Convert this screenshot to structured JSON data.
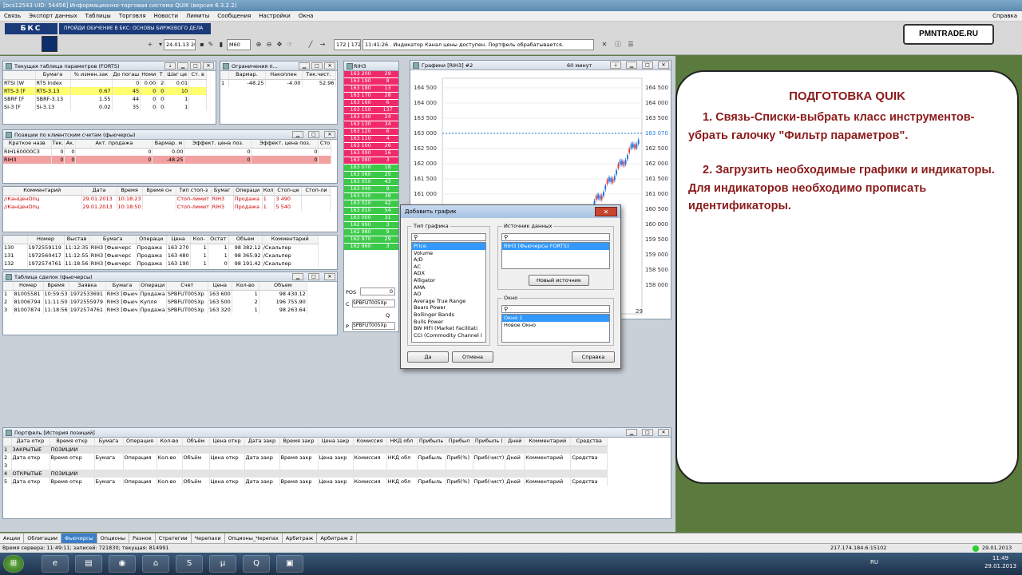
{
  "window_title": "[bcs12543  UID: 54456] Информационно-торговая система QUIK (версия 6.3.2.2)",
  "menu": [
    "Связь",
    "Экспорт данных",
    "Таблицы",
    "Торговля",
    "Новости",
    "Лимиты",
    "Сообщения",
    "Настройки",
    "Окна"
  ],
  "menu_help": "Справка",
  "toolbar": {
    "logo": "БКС",
    "banner": "ПРОЙДИ ОБУЧЕНИЕ В БКС: ОСНОВЫ БИРЖЕВОГО ДЕЛА",
    "date_field": "24.01.13 20",
    "interval_field": "M60",
    "msg_counter": "172 | 172",
    "msg_text": "11:41:26 . Индикатор Канал цены доступен. Портфель обрабатывается.",
    "watermark": "PMNTRADE.RU"
  },
  "params_table": {
    "title": "Текущая таблица параметров (FORTS)",
    "headers": [
      "",
      "Бумага",
      "% измен.",
      "Цена послед.",
      "Лот",
      "Шаг цены"
    ],
    "rows": [
      [
        "RTSI [W",
        "RTS Index",
        "",
        "0",
        "0.00",
        "2",
        "0.01"
      ],
      [
        "RTS-3 [F",
        "RTS-3.13",
        "0.67",
        "45",
        "0",
        "0",
        "10"
      ],
      [
        "SBRF [F",
        "SBRF-3.13",
        "1.55",
        "44",
        "0",
        "0",
        "1"
      ],
      [
        "SI-3 [F",
        "Si-3.13",
        "0.02",
        "35",
        "0",
        "0",
        "1"
      ]
    ],
    "header_labels": [
      "Бумага",
      "% измен.зак",
      "До погаш",
      "Номи",
      "Т",
      "Шаг це",
      "Ст. в"
    ]
  },
  "limits_table": {
    "title": "Ограничения п...",
    "headers": [
      "",
      "Вармар.",
      "Накоплен",
      "Тек.чист."
    ],
    "row": [
      "1",
      "-48.25",
      "-4.00",
      "52.96"
    ]
  },
  "positions_table": {
    "title": "Позиции по клиентским счетам (фьючерсы)",
    "headers": [
      "Краткое назв",
      "Тек.",
      "Ак.",
      "Акт. продажа",
      "Вармар. м",
      "Эффект. цена поз.",
      "Эффект. цена поз.",
      "Сто"
    ],
    "rows": [
      [
        "RIH160000СЗ",
        "0",
        "0",
        "0",
        "0.00",
        "0",
        "0"
      ],
      [
        "RIH3",
        "0",
        "0",
        "0",
        "-48.25",
        "0",
        "0"
      ]
    ]
  },
  "stops_table": {
    "headers": [
      "Комментарий",
      "Дата",
      "Время",
      "Время сн",
      "Тип стоп-з",
      "Бумаг",
      "Операци",
      "Кол",
      "Стоп-це",
      "Стоп-ли"
    ],
    "rows": [
      [
        "//КанЦенОпц",
        "29.01.2013",
        "10:18:23",
        "",
        "Стоп-лимит",
        "RIH3",
        "Продажа",
        "1",
        "3 490",
        ""
      ],
      [
        "//КанЦенОпц",
        "29.01.2013",
        "10:18:50",
        "",
        "Стоп-лимит",
        "RIH3",
        "Продажа",
        "1",
        "5 540",
        ""
      ]
    ]
  },
  "orders_table": {
    "headers": [
      "",
      "Номер",
      "Выстав",
      "Бумага",
      "Операци",
      "Цена",
      "Кол-",
      "Остат",
      "Объем",
      "Комментарий"
    ],
    "rows": [
      [
        "130",
        "1972559119",
        "11:12:35",
        "RIH3 [Фьючерс",
        "Продажа",
        "163 270",
        "1",
        "1",
        "98 382.12",
        "/Скальпер"
      ],
      [
        "131",
        "1972560417",
        "11:12:55",
        "RIH3 [Фьючерс",
        "Продажа",
        "163 480",
        "1",
        "1",
        "98 365.92",
        "/Скальпер"
      ],
      [
        "132",
        "1972574761",
        "11:18:56",
        "RIH3 [Фьючерс",
        "Продажа",
        "163 190",
        "1",
        "0",
        "98 191.42",
        "/Скальпер"
      ]
    ]
  },
  "trades_table": {
    "title": "Таблица сделок (фьючерсы)",
    "headers": [
      "",
      "Номер",
      "Время",
      "Заявка",
      "Бумага",
      "Операци",
      "Счет",
      "Цена",
      "Кол-во",
      "Объем"
    ],
    "rows": [
      [
        "1",
        "81005581",
        "10:59:53",
        "1972533691",
        "RIH3 [Фьюч",
        "Продажа",
        "SPBFUT005Xp",
        "163 600",
        "1",
        "98 430.12"
      ],
      [
        "2",
        "81006794",
        "11:11:50",
        "1972555979",
        "RIH3 [Фьюч",
        "Купля",
        "SPBFUT005Xp",
        "163 500",
        "2",
        "196 755.90"
      ],
      [
        "3",
        "81007874",
        "11:18:56",
        "1972574761",
        "RIH3 [Фьюч",
        "Продажа",
        "SPBFUT005Xp",
        "163 320",
        "1",
        "98 263.64"
      ]
    ]
  },
  "orderbook": {
    "title": "RIH3",
    "sell": [
      [
        "163 200",
        "29"
      ],
      [
        "163 190",
        "8"
      ],
      [
        "163 180",
        "13"
      ],
      [
        "163 170",
        "28"
      ],
      [
        "163 160",
        "6"
      ],
      [
        "163 150",
        "137"
      ],
      [
        "163 140",
        "24"
      ],
      [
        "163 130",
        "34"
      ],
      [
        "163 120",
        "6"
      ],
      [
        "163 110",
        "4"
      ],
      [
        "163 100",
        "26"
      ],
      [
        "163 090",
        "16"
      ],
      [
        "163 080",
        "3"
      ]
    ],
    "buy": [
      [
        "163 070",
        "18"
      ],
      [
        "163 060",
        "25"
      ],
      [
        "163 050",
        "43"
      ],
      [
        "163 040",
        "9"
      ],
      [
        "163 030",
        "38"
      ],
      [
        "163 020",
        "42"
      ],
      [
        "163 010",
        "54"
      ],
      [
        "163 000",
        "31"
      ],
      [
        "162 990",
        "3"
      ],
      [
        "162 980",
        "9"
      ],
      [
        "162 970",
        "29"
      ],
      [
        "162 960",
        "3"
      ]
    ],
    "pos_label": "POS",
    "pos_value": "0",
    "account_c": "SPBFUT005Xp",
    "account_p": "SPBFUT005Xp",
    "row_labels": [
      "C",
      "Q",
      "P"
    ]
  },
  "chart": {
    "title": "Графики [RIH3] #2",
    "interval": "60 минут",
    "left_ticks": [
      "164 500",
      "164 000",
      "163 500",
      "163 000",
      "162 500",
      "162 000",
      "161 500",
      "161 000"
    ],
    "right_ticks": [
      "164 500",
      "164 000",
      "163 500",
      "163 070",
      "162 500",
      "162 000",
      "161 500",
      "161 000",
      "160 500",
      "160 000",
      "159 500",
      "159 000",
      "158 500",
      "158 000"
    ],
    "last_price": "163 070",
    "date_tick": "29"
  },
  "dialog": {
    "title": "Добавить график",
    "type_label": "Тип графика",
    "types": [
      "Price",
      "Volume",
      "A/D",
      "AC",
      "ADX",
      "Alligator",
      "AMA",
      "AO",
      "Average True Range",
      "Bears Power",
      "Bollinger Bands",
      "Bulls Power",
      "BW MFI (Market Facilitati",
      "CCI (Commodity Channel I"
    ],
    "selected_type": "Price",
    "source_label": "Источник данных",
    "sources": [
      "RIH3 [Фьючерсы FORTS]"
    ],
    "new_source_btn": "Новый источник",
    "window_label": "Окно",
    "windows": [
      "Окно 1",
      "Новое Окно"
    ],
    "ok_btn": "Да",
    "cancel_btn": "Отмена",
    "help_btn": "Справка"
  },
  "portfolio": {
    "title": "Портфель [История позиций]",
    "headers": [
      "",
      "Дата откр",
      "Время откр",
      "Бумага",
      "Операция",
      "Кол-во",
      "Объём",
      "Цена откр",
      "Дата закр",
      "Время закр",
      "Цена закр",
      "Комиссия",
      "НКД обл",
      "Прибыль",
      "Прибыл",
      "Прибыль (",
      "Дней",
      "Комментарий",
      "Средства"
    ],
    "rows": [
      [
        "1",
        "ЗАКРЫТЫЕ",
        "ПОЗИЦИИ",
        "",
        "",
        "",
        "",
        "",
        "",
        "",
        "",
        "",
        "",
        "",
        "",
        "",
        "",
        "",
        ""
      ],
      [
        "2",
        "Дата откр",
        "Время откр",
        "Бумага",
        "Операция",
        "Кол-во",
        "Объём",
        "Цена откр",
        "Дата закр",
        "Время закр",
        "Цена закр",
        "Комиссия",
        "НКД обл",
        "Прибыль",
        "Приб(%)",
        "Приб(чист)",
        "Дней",
        "Комментарий",
        "Средства"
      ],
      [
        "3",
        "",
        "",
        "",
        "",
        "",
        "",
        "",
        "",
        "",
        "",
        "",
        "",
        "",
        "",
        "",
        "",
        "",
        ""
      ],
      [
        "4",
        "ОТКРЫТЫЕ",
        "ПОЗИЦИИ",
        "",
        "",
        "",
        "",
        "",
        "",
        "",
        "",
        "",
        "",
        "",
        "",
        "",
        "",
        "",
        ""
      ],
      [
        "5",
        "Дата откр",
        "Время откр",
        "Бумага",
        "Операция",
        "Кол-во",
        "Объём",
        "Цена откр",
        "Дата закр",
        "Время закр",
        "Цена закр",
        "Комиссия",
        "НКД обл",
        "Прибыль",
        "Приб(%)",
        "Приб(чист)",
        "Дней",
        "Комментарий",
        "Средства"
      ]
    ]
  },
  "tabs": [
    "Акции",
    "Облигации",
    "Фьючерсы",
    "Опционы",
    "Разное",
    "Стратегии",
    "Черепахи",
    "Опционы_Черепах",
    "Арбитраж",
    "Арбитраж 2"
  ],
  "active_tab": "Фьючерсы",
  "status": {
    "server_time": "Время сервера: 11:49:11; записей: 721830; текущая: 814991",
    "connection": "217.174.184.6:15102",
    "date": "29.01.2013"
  },
  "taskbar": {
    "lang": "RU",
    "time": "11:49",
    "date": "29.01.2013"
  },
  "note": {
    "heading": "ПОДГОТОВКА QUIK",
    "p1": "1. Связь-Списки-выбрать класс инструментов-убрать галочку \"Фильтр параметров\".",
    "p2": "2. Загрузить необходимые графики и индикаторы. Для индикаторов необходимо прописать идентификаторы."
  },
  "colors": {
    "sell": "#f02a6a",
    "buy": "#3cc94a",
    "note_text": "#8b1b1b",
    "select": "#3399ff"
  }
}
